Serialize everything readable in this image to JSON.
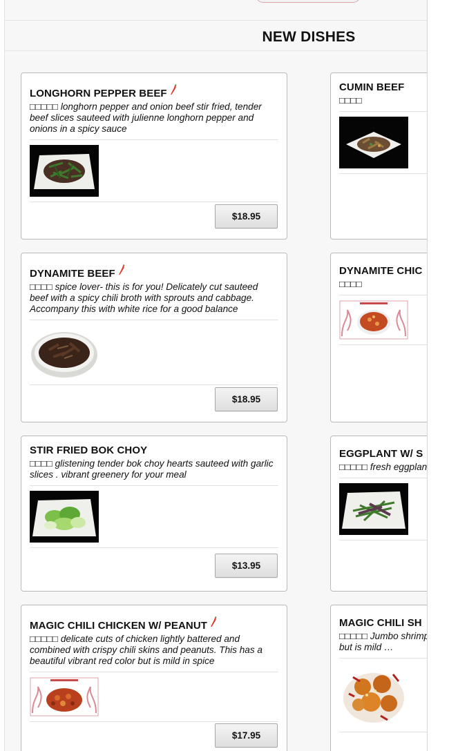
{
  "section": {
    "title": "NEW DISHES"
  },
  "dishes": [
    {
      "name": "LONGHORN PEPPER BEEF",
      "spicy": true,
      "cn": "□□□□□",
      "desc": "longhorn pepper and onion beef stir fried, tender beef slices sauteed with julienne longhorn pepper and onions in a spicy sauce",
      "price": "$18.95"
    },
    {
      "name": "CUMIN BEEF",
      "spicy": false,
      "cn": "□□□□",
      "desc": ""
    },
    {
      "name": "DYNAMITE BEEF",
      "spicy": true,
      "cn": "□□□□",
      "desc": "spice lover- this is for you! Delicately cut sauteed beef with a spicy chili broth with sprouts and cabbage. Accompany this with white rice for a good balance",
      "price": "$18.95"
    },
    {
      "name": "DYNAMITE CHIC",
      "spicy": false,
      "cn": "□□□□",
      "desc": ""
    },
    {
      "name": "STIR FRIED BOK CHOY",
      "spicy": false,
      "cn": "□□□□",
      "desc": "glistening tender bok choy hearts sauteed with garlic slices . vibrant greenery for your meal",
      "price": "$13.95"
    },
    {
      "name": "EGGPLANT W/ S",
      "spicy": false,
      "cn": "□□□□□",
      "desc": "fresh eggplant a… sauteed with pepper"
    },
    {
      "name": "MAGIC CHILI CHICKEN W/ PEANUT",
      "spicy": true,
      "cn": "□□□□□",
      "desc": "delicate cuts of chicken lightly battered and combined with crispy chili skins and peanuts. This has a beautiful vibrant red color but is mild in spice",
      "price": "$17.95"
    },
    {
      "name": "MAGIC CHILI SH",
      "spicy": false,
      "cn": "□□□□□",
      "desc": "Jumbo shrimp li… crispy chili skins and… red color but is mild …"
    }
  ],
  "icons": {
    "chili": "chili-pepper-icon"
  },
  "colors": {
    "chili": "#e0352b",
    "frame_accent": "#d7a4ab"
  }
}
